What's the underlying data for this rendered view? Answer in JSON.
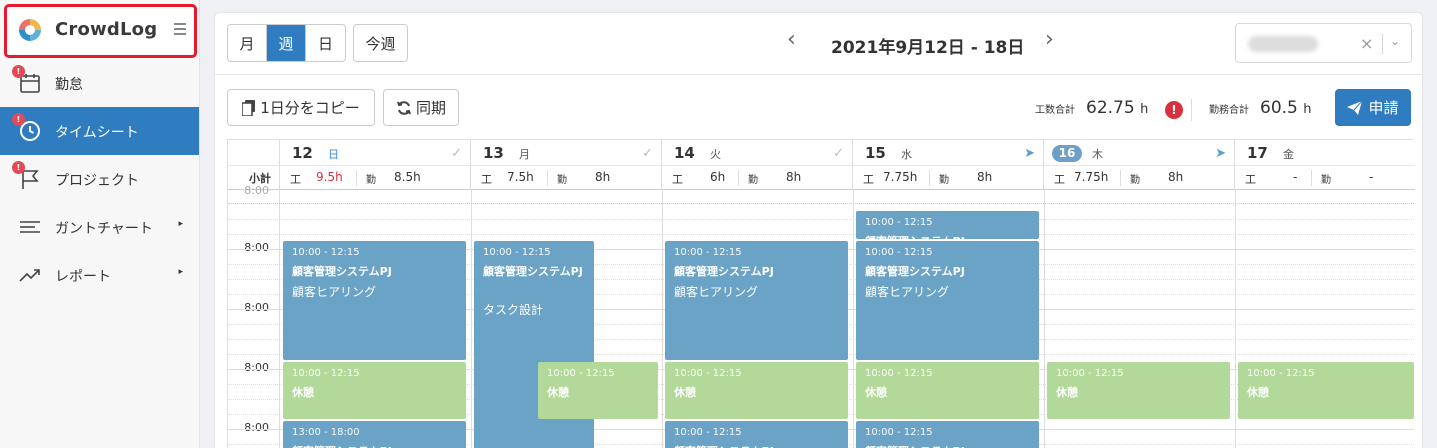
{
  "app": {
    "name": "CrowdLog"
  },
  "sidebar": {
    "items": [
      {
        "label": "勤怠",
        "icon": "calendar-icon",
        "badge": "!"
      },
      {
        "label": "タイムシート",
        "icon": "clock-icon",
        "badge": "!",
        "active": true
      },
      {
        "label": "プロジェクト",
        "icon": "flag-icon",
        "badge": "!"
      },
      {
        "label": "ガントチャート",
        "icon": "gantt-icon",
        "caret": "▸"
      },
      {
        "label": "レポート",
        "icon": "trend-icon",
        "caret": "▸"
      }
    ]
  },
  "header": {
    "view_month": "月",
    "view_week": "週",
    "view_day": "日",
    "this_week": "今週",
    "prev": "‹",
    "next": "›",
    "date_range": "2021年9月12日 - 18日",
    "clear": "×",
    "dropdown": "⌄"
  },
  "toolbar": {
    "copy_label": "1日分をコピー",
    "sync_label": "同期",
    "work_total_label": "工数合計",
    "work_total_value": "62.75",
    "work_total_unit": "h",
    "alert": "!",
    "duty_total_label": "勤務合計",
    "duty_total_value": "60.5",
    "duty_total_unit": "h",
    "apply_label": "申請"
  },
  "grid": {
    "subtotal_label": "小計",
    "e_label": "工",
    "k_label": "勤",
    "time_labels": [
      "8:00",
      "8:00",
      "8:00",
      "8:00",
      "8:00"
    ],
    "partial_top_label": "8:00",
    "days": [
      {
        "num": "12",
        "wd": "日",
        "status": "✓",
        "e": "9.5h",
        "k": "8.5h"
      },
      {
        "num": "13",
        "wd": "月",
        "status": "✓",
        "e": "7.5h",
        "k": "8h"
      },
      {
        "num": "14",
        "wd": "火",
        "status": "✓",
        "e": "6h",
        "k": "8h"
      },
      {
        "num": "15",
        "wd": "水",
        "status": "➤",
        "e": "7.75h",
        "k": "8h"
      },
      {
        "num": "16",
        "wd": "木",
        "status": "➤",
        "e": "7.75h",
        "k": "8h"
      },
      {
        "num": "17",
        "wd": "金",
        "status": "",
        "e": "-",
        "k": "-"
      }
    ],
    "events": {
      "blue_time": "10:00 - 12:15",
      "project": "顧客管理システムPJ",
      "task_hearing": "顧客ヒアリング",
      "task_design": "タスク設計",
      "break_time": "10:00 - 12:15",
      "break_label": "休憩",
      "late_time": "13:00 - 18:00"
    }
  },
  "colors": {
    "accent": "#2f7cc0",
    "event_blue": "#6aa3c6",
    "event_green": "#b2d99a",
    "alert": "#d9303e",
    "highlight_box": "#e8192c"
  }
}
